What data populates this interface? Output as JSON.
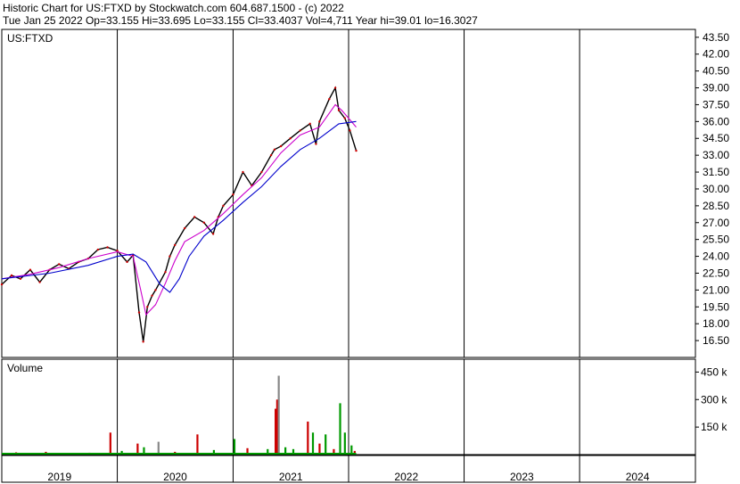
{
  "header": {
    "line1": "Historic Chart for US:FTXD by Stockwatch.com 604.687.1500 - (c) 2022",
    "line2": "Tue Jan 25 2022   Op=33.155   Hi=33.695   Lo=33.155   Cl=33.4037   Vol=4,711   Year hi=39.01   lo=16.3027"
  },
  "chart_data": [
    {
      "type": "line",
      "label": "US:FTXD",
      "y_ticks": [
        "43.50",
        "42.00",
        "40.50",
        "39.00",
        "37.50",
        "36.00",
        "34.50",
        "33.00",
        "31.50",
        "30.00",
        "28.50",
        "27.00",
        "25.50",
        "24.00",
        "22.50",
        "21.00",
        "19.50",
        "18.00",
        "16.50"
      ],
      "ylim": [
        15.0,
        44.2
      ],
      "x_ticks": [
        "2019",
        "2020",
        "2021",
        "2022",
        "2023",
        "2024"
      ],
      "x_range": [
        "2019-01",
        "2024-12"
      ],
      "series": [
        {
          "kind": "price",
          "color": "#000000",
          "x": [
            "2019-01-01",
            "2019-02-01",
            "2019-03-01",
            "2019-04-01",
            "2019-05-01",
            "2019-06-01",
            "2019-07-01",
            "2019-08-01",
            "2019-09-01",
            "2019-10-01",
            "2019-11-01",
            "2019-12-01",
            "2020-01-01",
            "2020-02-01",
            "2020-02-20",
            "2020-03-10",
            "2020-03-23",
            "2020-04-05",
            "2020-04-20",
            "2020-05-01",
            "2020-06-01",
            "2020-06-15",
            "2020-07-01",
            "2020-08-01",
            "2020-09-01",
            "2020-10-01",
            "2020-10-30",
            "2020-11-15",
            "2020-12-01",
            "2021-01-01",
            "2021-02-01",
            "2021-03-01",
            "2021-04-01",
            "2021-05-01",
            "2021-05-12",
            "2021-06-01",
            "2021-07-01",
            "2021-08-01",
            "2021-09-01",
            "2021-09-20",
            "2021-10-01",
            "2021-11-01",
            "2021-11-20",
            "2021-12-01",
            "2021-12-20",
            "2022-01-05",
            "2022-01-25"
          ],
          "y": [
            21.5,
            22.3,
            22.0,
            22.8,
            21.7,
            22.8,
            23.3,
            22.9,
            23.5,
            23.8,
            24.6,
            24.8,
            24.5,
            23.5,
            24.1,
            19.0,
            16.4,
            19.5,
            20.5,
            21.0,
            22.6,
            24.0,
            25.0,
            26.5,
            27.5,
            27.0,
            26.0,
            27.5,
            28.5,
            29.5,
            31.5,
            30.3,
            31.5,
            33.0,
            33.5,
            33.8,
            34.5,
            35.2,
            35.8,
            34.0,
            36.0,
            38.0,
            39.0,
            37.0,
            36.3,
            35.2,
            33.4
          ]
        },
        {
          "kind": "short-ma",
          "color": "#cc00cc",
          "x": [
            "2019-01-01",
            "2019-04-01",
            "2019-07-01",
            "2019-10-01",
            "2020-01-01",
            "2020-02-20",
            "2020-03-15",
            "2020-04-01",
            "2020-05-01",
            "2020-06-01",
            "2020-07-01",
            "2020-08-01",
            "2020-10-01",
            "2020-12-01",
            "2021-02-01",
            "2021-04-01",
            "2021-06-01",
            "2021-08-01",
            "2021-10-01",
            "2021-11-20",
            "2021-12-10",
            "2022-01-01",
            "2022-01-25"
          ],
          "y": [
            22.0,
            22.4,
            23.0,
            23.8,
            24.4,
            24.0,
            21.0,
            18.8,
            19.7,
            21.6,
            23.6,
            25.3,
            26.3,
            27.8,
            29.5,
            31.0,
            33.2,
            34.8,
            35.5,
            37.5,
            37.0,
            36.3,
            35.5
          ]
        },
        {
          "kind": "long-ma",
          "color": "#0000cc",
          "x": [
            "2019-01-01",
            "2019-06-01",
            "2019-10-01",
            "2020-01-01",
            "2020-02-20",
            "2020-04-01",
            "2020-05-15",
            "2020-06-15",
            "2020-07-15",
            "2020-08-15",
            "2020-10-01",
            "2020-12-01",
            "2021-02-01",
            "2021-04-01",
            "2021-06-01",
            "2021-08-01",
            "2021-10-01",
            "2021-12-01",
            "2022-01-25"
          ],
          "y": [
            22.0,
            22.5,
            23.2,
            24.0,
            24.2,
            23.5,
            21.5,
            20.8,
            22.0,
            24.0,
            25.8,
            27.2,
            28.8,
            30.2,
            32.0,
            33.5,
            34.5,
            35.8,
            36.0
          ]
        }
      ]
    },
    {
      "type": "bar",
      "label": "Volume",
      "y_ticks": [
        "450 k",
        "300 k",
        "150 k"
      ],
      "ylim": [
        0,
        520000
      ],
      "bars": [
        {
          "x": "2019-02-15",
          "v": 12000,
          "c": "#cc0000"
        },
        {
          "x": "2019-05-20",
          "v": 15000,
          "c": "#cc0000"
        },
        {
          "x": "2019-08-10",
          "v": 9000,
          "c": "#009900"
        },
        {
          "x": "2019-10-05",
          "v": 10000,
          "c": "#cc0000"
        },
        {
          "x": "2019-12-10",
          "v": 120000,
          "c": "#cc0000"
        },
        {
          "x": "2020-01-15",
          "v": 20000,
          "c": "#009900"
        },
        {
          "x": "2020-03-05",
          "v": 60000,
          "c": "#cc0000"
        },
        {
          "x": "2020-03-25",
          "v": 40000,
          "c": "#009900"
        },
        {
          "x": "2020-05-10",
          "v": 70000,
          "c": "#888888"
        },
        {
          "x": "2020-07-01",
          "v": 15000,
          "c": "#cc0000"
        },
        {
          "x": "2020-09-10",
          "v": 110000,
          "c": "#cc0000"
        },
        {
          "x": "2020-11-01",
          "v": 25000,
          "c": "#009900"
        },
        {
          "x": "2021-01-05",
          "v": 85000,
          "c": "#009900"
        },
        {
          "x": "2021-02-15",
          "v": 35000,
          "c": "#cc0000"
        },
        {
          "x": "2021-04-20",
          "v": 30000,
          "c": "#009900"
        },
        {
          "x": "2021-05-15",
          "v": 250000,
          "c": "#cc0000"
        },
        {
          "x": "2021-05-20",
          "v": 300000,
          "c": "#cc0000"
        },
        {
          "x": "2021-05-25",
          "v": 430000,
          "c": "#888888"
        },
        {
          "x": "2021-06-15",
          "v": 40000,
          "c": "#009900"
        },
        {
          "x": "2021-07-10",
          "v": 30000,
          "c": "#009900"
        },
        {
          "x": "2021-08-25",
          "v": 180000,
          "c": "#cc0000"
        },
        {
          "x": "2021-09-10",
          "v": 120000,
          "c": "#009900"
        },
        {
          "x": "2021-10-01",
          "v": 60000,
          "c": "#cc0000"
        },
        {
          "x": "2021-10-20",
          "v": 110000,
          "c": "#009900"
        },
        {
          "x": "2021-11-15",
          "v": 30000,
          "c": "#cc0000"
        },
        {
          "x": "2021-12-05",
          "v": 280000,
          "c": "#009900"
        },
        {
          "x": "2021-12-20",
          "v": 120000,
          "c": "#009900"
        },
        {
          "x": "2022-01-10",
          "v": 50000,
          "c": "#009900"
        },
        {
          "x": "2022-01-20",
          "v": 20000,
          "c": "#cc0000"
        }
      ]
    }
  ]
}
